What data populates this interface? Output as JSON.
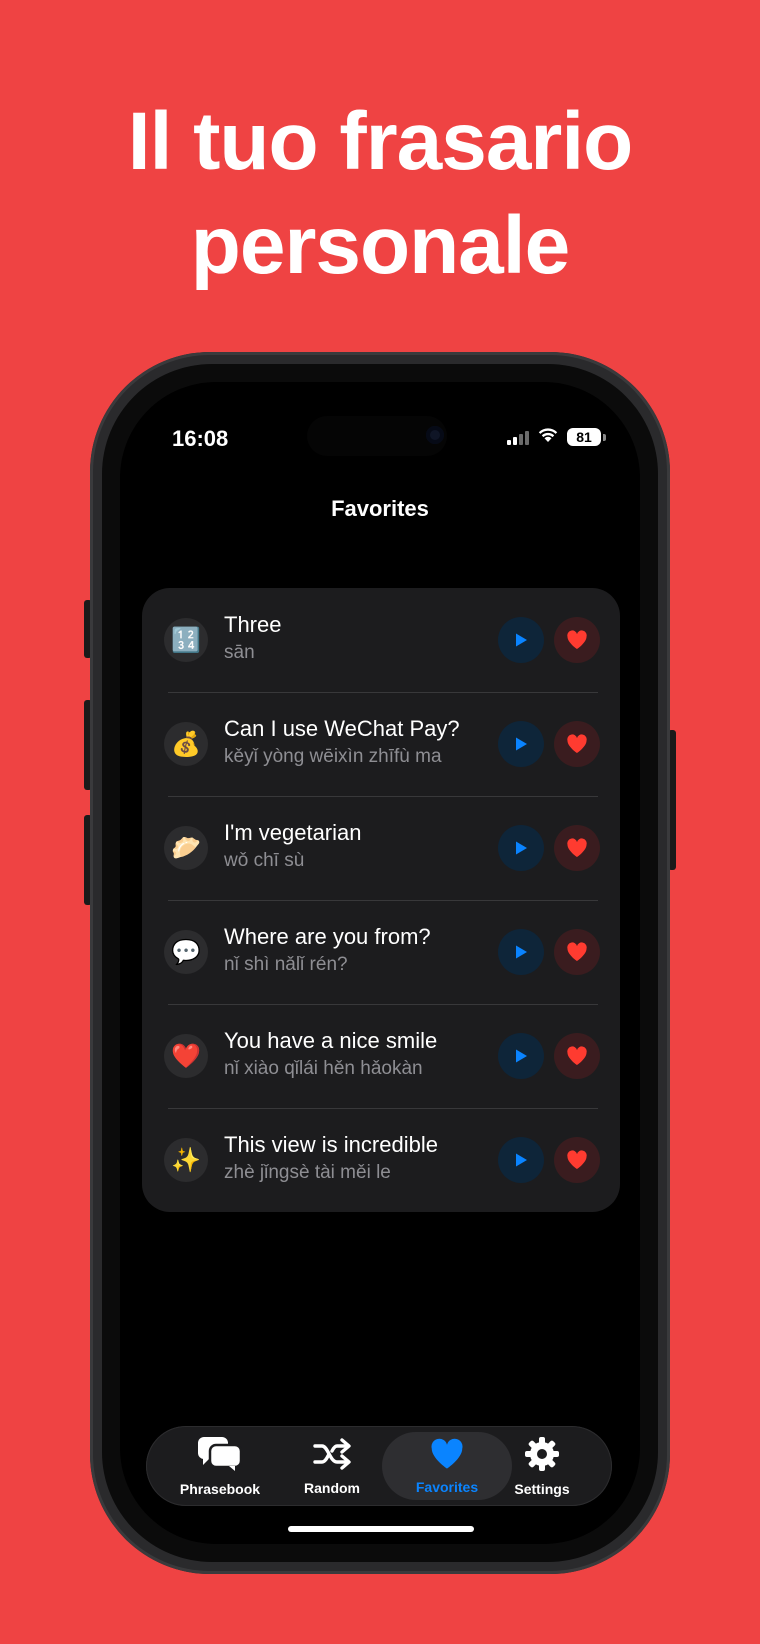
{
  "promo": {
    "title_line1": "Il tuo frasario",
    "title_line2": "personale",
    "background_color": "#EF4343"
  },
  "status_bar": {
    "time": "16:08",
    "battery": "81"
  },
  "nav": {
    "title": "Favorites"
  },
  "favorites": [
    {
      "emoji": "🔢",
      "icon": "numbers-icon",
      "text": "Three",
      "pinyin": "sān"
    },
    {
      "emoji": "💰",
      "icon": "money-bag-icon",
      "text": "Can I use WeChat Pay?",
      "pinyin": "kěyǐ yòng wēixìn zhīfù ma"
    },
    {
      "emoji": "🥟",
      "icon": "dumpling-icon",
      "text": "I'm vegetarian",
      "pinyin": "wǒ chī sù"
    },
    {
      "emoji": "💬",
      "icon": "speech-bubble-icon",
      "text": "Where are you from?",
      "pinyin": "nǐ shì nǎlǐ rén?"
    },
    {
      "emoji": "❤️",
      "icon": "red-heart-icon",
      "text": "You have a nice smile",
      "pinyin": "nǐ xiào qǐlái hěn hǎokàn"
    },
    {
      "emoji": "✨",
      "icon": "sparkles-icon",
      "text": "This view is incredible",
      "pinyin": "zhè jǐngsè tài měi le"
    }
  ],
  "tabs": [
    {
      "label": "Phrasebook",
      "icon": "chat-bubbles-icon",
      "active": false
    },
    {
      "label": "Random",
      "icon": "shuffle-icon",
      "active": false
    },
    {
      "label": "Favorites",
      "icon": "heart-icon",
      "active": true
    },
    {
      "label": "Settings",
      "icon": "gear-icon",
      "active": false
    }
  ],
  "colors": {
    "accent_blue": "#0A84FF",
    "heart_red": "#FF3B30",
    "card": "#1C1C1E",
    "pinyin_gray": "#8E8E93"
  }
}
